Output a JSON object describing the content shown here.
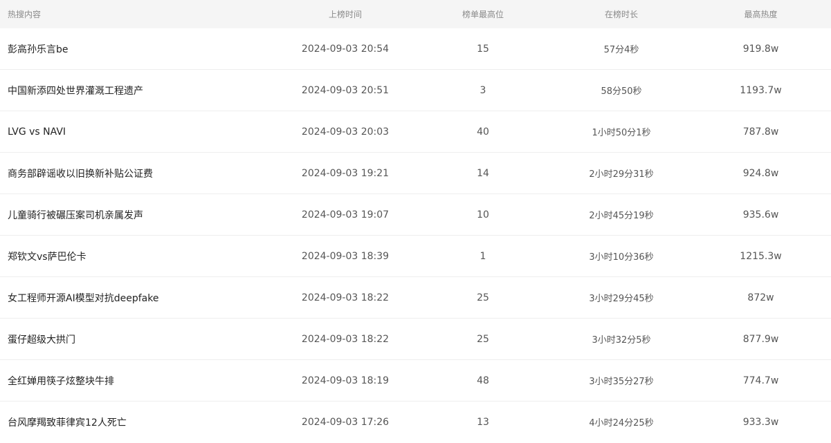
{
  "table": {
    "headers": {
      "topic": "热搜内容",
      "time": "上榜时间",
      "rank": "榜单最高位",
      "duration": "在榜时长",
      "heat": "最高热度"
    },
    "rows": [
      {
        "topic": "彭高孙乐言be",
        "time": "2024-09-03 20:54",
        "rank": "15",
        "duration": "57分4秒",
        "heat": "919.8w"
      },
      {
        "topic": "中国新添四处世界灌溉工程遗产",
        "time": "2024-09-03 20:51",
        "rank": "3",
        "duration": "58分50秒",
        "heat": "1193.7w"
      },
      {
        "topic": "LVG vs NAVI",
        "time": "2024-09-03 20:03",
        "rank": "40",
        "duration": "1小时50分1秒",
        "heat": "787.8w"
      },
      {
        "topic": "商务部辟谣收以旧换新补贴公证费",
        "time": "2024-09-03 19:21",
        "rank": "14",
        "duration": "2小时29分31秒",
        "heat": "924.8w"
      },
      {
        "topic": "儿童骑行被碾压案司机亲属发声",
        "time": "2024-09-03 19:07",
        "rank": "10",
        "duration": "2小时45分19秒",
        "heat": "935.6w"
      },
      {
        "topic": "郑钦文vs萨巴伦卡",
        "time": "2024-09-03 18:39",
        "rank": "1",
        "duration": "3小时10分36秒",
        "heat": "1215.3w"
      },
      {
        "topic": "女工程师开源AI模型对抗deepfake",
        "time": "2024-09-03 18:22",
        "rank": "25",
        "duration": "3小时29分45秒",
        "heat": "872w"
      },
      {
        "topic": "蛋仔超级大拱门",
        "time": "2024-09-03 18:22",
        "rank": "25",
        "duration": "3小时32分5秒",
        "heat": "877.9w"
      },
      {
        "topic": "全红婵用筷子炫整块牛排",
        "time": "2024-09-03 18:19",
        "rank": "48",
        "duration": "3小时35分27秒",
        "heat": "774.7w"
      },
      {
        "topic": "台风摩羯致菲律宾12人死亡",
        "time": "2024-09-03 17:26",
        "rank": "13",
        "duration": "4小时24分25秒",
        "heat": "933.3w"
      }
    ]
  }
}
